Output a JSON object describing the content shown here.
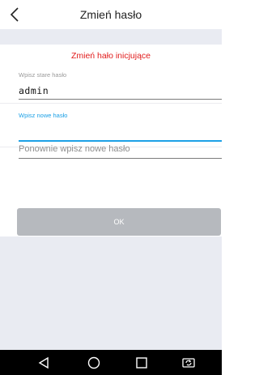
{
  "header": {
    "title": "Zmień hasło",
    "back_icon": "chevron-left-icon"
  },
  "form": {
    "error_message": "Zmień hało inicjujące",
    "old_password": {
      "label": "Wpisz stare hasło",
      "value": "admin"
    },
    "new_password": {
      "label": "Wpisz nowe hasło",
      "value": ""
    },
    "confirm_password": {
      "placeholder": "Ponownie wpisz nowe hasło"
    },
    "ok_label": "OK"
  },
  "colors": {
    "error": "#e11b1b",
    "accent": "#1da1e6",
    "band": "#e9ebf2",
    "button_disabled": "#b6b9be"
  },
  "navbar": {
    "icons": [
      "back-triangle-icon",
      "home-circle-icon",
      "recents-square-icon",
      "screen-rotate-icon"
    ]
  }
}
